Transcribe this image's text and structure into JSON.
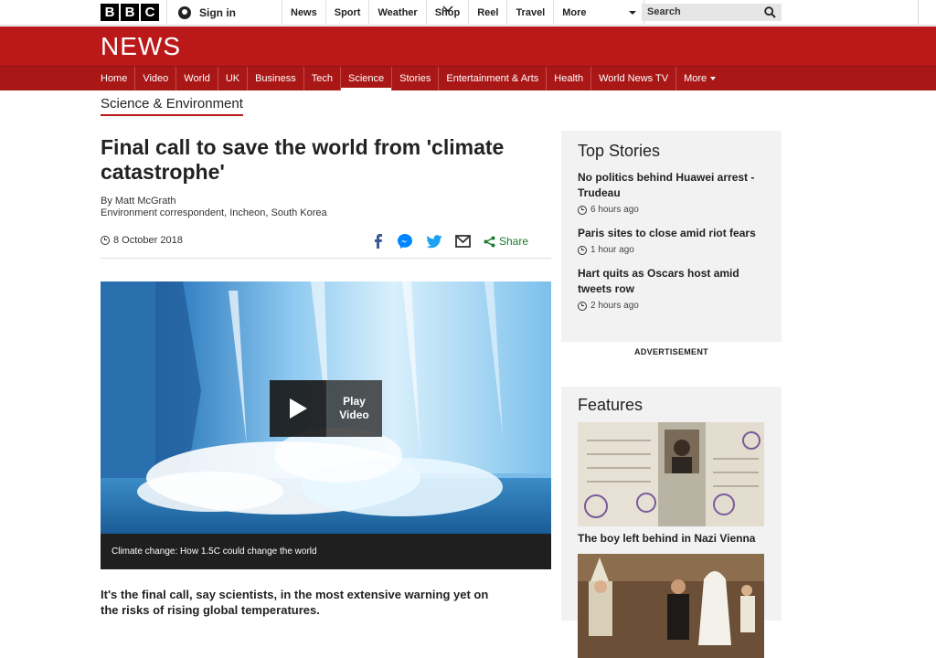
{
  "top_bar": {
    "logo_letters": [
      "B",
      "B",
      "C"
    ],
    "sign_in": "Sign in",
    "nav": [
      "News",
      "Sport",
      "Weather",
      "Shop",
      "Reel",
      "Travel"
    ],
    "more": "More",
    "search_placeholder": "Search"
  },
  "news_bar": {
    "wordmark": "NEWS"
  },
  "section_nav": {
    "items": [
      {
        "label": "Home"
      },
      {
        "label": "Video"
      },
      {
        "label": "World"
      },
      {
        "label": "UK"
      },
      {
        "label": "Business"
      },
      {
        "label": "Tech"
      },
      {
        "label": "Science",
        "active": true
      },
      {
        "label": "Stories"
      },
      {
        "label": "Entertainment & Arts"
      },
      {
        "label": "Health"
      },
      {
        "label": "World News TV"
      },
      {
        "label": "More"
      }
    ]
  },
  "subsection": "Science & Environment",
  "article": {
    "headline": "Final call to save the world from 'climate catastrophe'",
    "author": "By Matt McGrath",
    "author_role": "Environment correspondent, Incheon, South Korea",
    "date": "8 October 2018",
    "share_label": "Share",
    "media": {
      "play_line1": "Play",
      "play_line2": "Video",
      "caption": "Climate change: How 1.5C could change the world"
    },
    "intro": "It's the final call, say scientists, in the most extensive warning yet on the risks of rising global temperatures."
  },
  "sidebar": {
    "top_stories_title": "Top Stories",
    "stories": [
      {
        "title": "No politics behind Huawei arrest - Trudeau",
        "time": "6 hours ago"
      },
      {
        "title": "Paris sites to close amid riot fears",
        "time": "1 hour ago"
      },
      {
        "title": "Hart quits as Oscars host amid tweets row",
        "time": "2 hours ago"
      }
    ],
    "advertisement": "ADVERTISEMENT",
    "features_title": "Features",
    "features": [
      {
        "title": "The boy left behind in Nazi Vienna"
      }
    ]
  },
  "colors": {
    "brand_red": "#bb1919",
    "nav_red": "#a91717",
    "share_green": "#1a7a2f"
  }
}
